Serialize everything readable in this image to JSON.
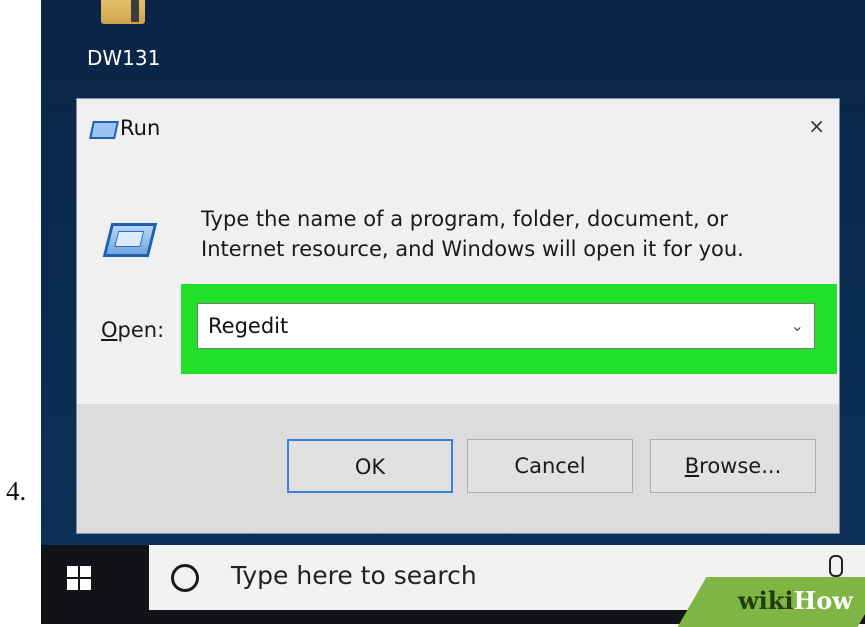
{
  "step_number": "4.",
  "desktop": {
    "icon_label": "DW131"
  },
  "dialog": {
    "title": "Run",
    "close_glyph": "×",
    "description_line1": "Type the name of a program, folder, document, or",
    "description_line2": "Internet resource, and Windows will open it for you.",
    "open_label_first": "O",
    "open_label_rest": "pen:",
    "open_value": "Regedit",
    "dropdown_glyph": "⌄",
    "highlight_color": "#21e02a",
    "buttons": {
      "ok": "OK",
      "cancel": "Cancel",
      "browse_first": "B",
      "browse_rest": "rowse..."
    }
  },
  "taskbar": {
    "search_placeholder": "Type here to search",
    "icons": [
      "windows-start-icon",
      "cortana-ring-icon",
      "microphone-icon"
    ]
  },
  "watermark": {
    "part1": "wiki",
    "part2": "How"
  }
}
